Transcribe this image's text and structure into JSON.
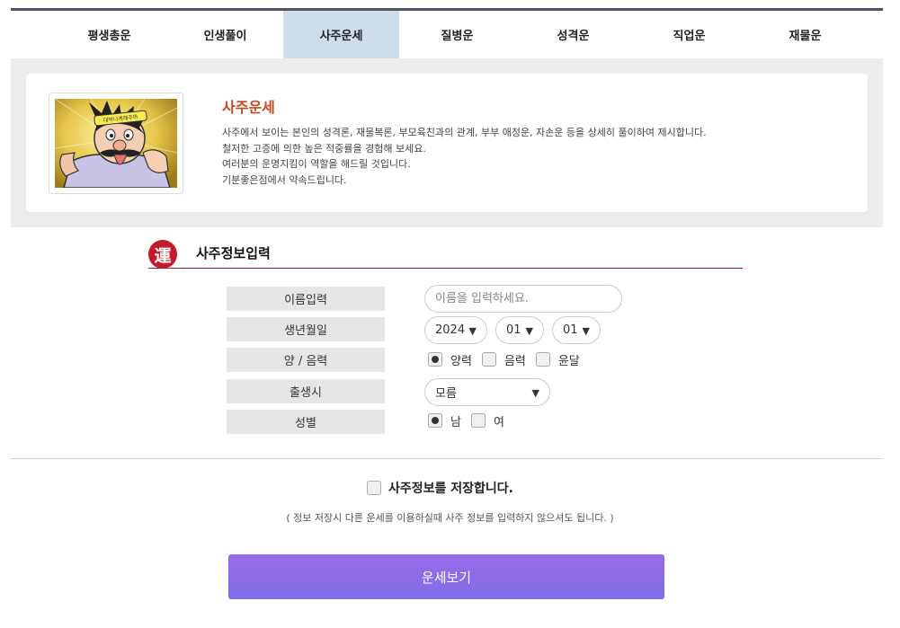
{
  "tabs": [
    {
      "label": "평생총운",
      "active": false
    },
    {
      "label": "인생풀이",
      "active": false
    },
    {
      "label": "사주운세",
      "active": true
    },
    {
      "label": "질병운",
      "active": false
    },
    {
      "label": "성격운",
      "active": false
    },
    {
      "label": "직업운",
      "active": false
    },
    {
      "label": "재물운",
      "active": false
    }
  ],
  "intro": {
    "title": "사주운세",
    "headband_text": "대박나게해주마",
    "lines": [
      "사주에서 보이는 본인의 성격론, 재물복론, 부모육친과의 관계, 부부 애정운, 자손운 등을 상세히 풀이하여 제시합니다.",
      "철저한 고증에 의한 높은 적중률을 경험해 보세요.",
      "여러분의 운명지킴이 역할을 해드릴 것입니다.",
      "기분좋은점에서 약속드립니다."
    ]
  },
  "section": {
    "seal_char": "運",
    "title": "사주정보입력"
  },
  "form": {
    "labels": {
      "name": "이름입력",
      "birth": "생년월일",
      "calendar": "양 / 음력",
      "birth_time": "출생시",
      "gender": "성별"
    },
    "name_placeholder": "이름을 입력하세요.",
    "year": "2024",
    "month": "01",
    "day": "01",
    "birth_time": "모름",
    "caret": "▼",
    "calendar_options": [
      {
        "label": "양력",
        "checked": true
      },
      {
        "label": "음력",
        "checked": false
      },
      {
        "label": "윤달",
        "checked": false
      }
    ],
    "gender_options": [
      {
        "label": "남",
        "checked": true
      },
      {
        "label": "여",
        "checked": false
      }
    ]
  },
  "save": {
    "label": "사주정보를 저장합니다.",
    "checked": false,
    "note": "( 정보 저장시 다른 운세를 이용하실때 사주 정보를 입력하지 않으셔도 됩니다. )"
  },
  "submit_label": "운세보기",
  "colors": {
    "tab_active": "#cfdcea",
    "accent_title": "#c9491e",
    "seal": "#c21a2a",
    "button_top": "#9a6ae8",
    "button_bottom": "#7f6ee8"
  }
}
